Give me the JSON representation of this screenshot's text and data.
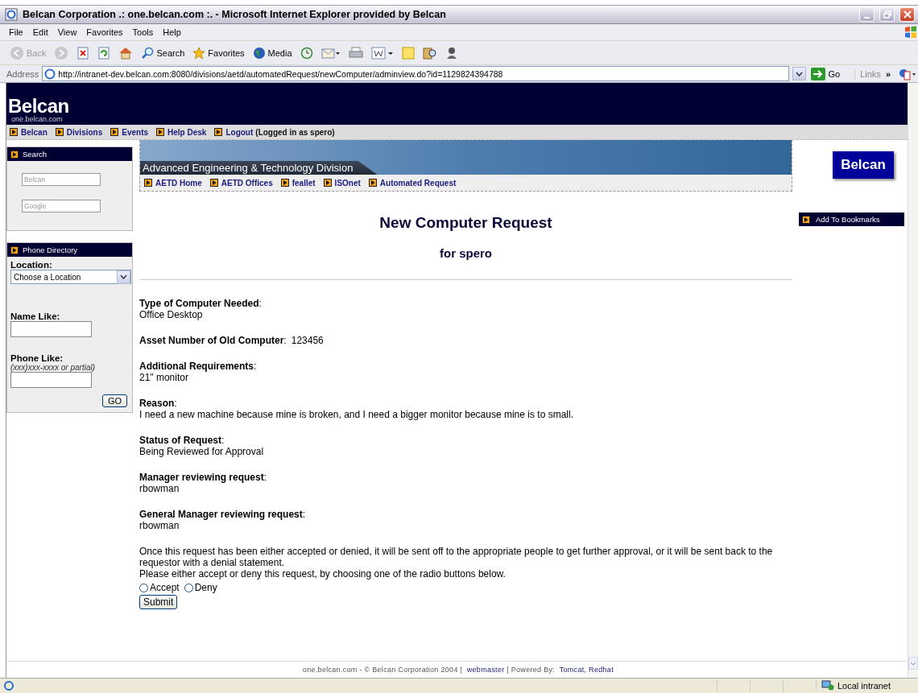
{
  "window": {
    "title": "Belcan Corporation .: one.belcan.com :. - Microsoft Internet Explorer provided by Belcan"
  },
  "menu": [
    "File",
    "Edit",
    "View",
    "Favorites",
    "Tools",
    "Help"
  ],
  "toolbar": [
    {
      "kind": "back",
      "label": "Back",
      "disabled": true
    },
    {
      "kind": "forward",
      "disabled": true
    },
    {
      "kind": "stop",
      "disabled": false
    },
    {
      "kind": "refresh",
      "disabled": false
    },
    {
      "kind": "home",
      "disabled": false
    },
    {
      "kind": "search",
      "label": "Search",
      "disabled": false
    },
    {
      "kind": "favorites",
      "label": "Favorites",
      "disabled": false
    },
    {
      "kind": "media",
      "label": "Media",
      "disabled": false
    },
    {
      "kind": "history",
      "disabled": false
    },
    {
      "kind": "mail",
      "disabled": false
    },
    {
      "kind": "print",
      "disabled": false
    },
    {
      "kind": "edit",
      "disabled": false
    },
    {
      "kind": "notes",
      "disabled": false
    },
    {
      "kind": "research",
      "disabled": false
    },
    {
      "kind": "messenger",
      "disabled": false
    }
  ],
  "address": {
    "label": "Address",
    "url": "http://intranet-dev.belcan.com:8080/divisions/aetd/automatedRequest/newComputer/adminview.do?id=1129824394788",
    "go": "Go",
    "links": "Links",
    "more": "»"
  },
  "site": {
    "logo": "Belcan",
    "logo_sub": "one.belcan.com",
    "nav": [
      "Belcan",
      "Divisions",
      "Events",
      "Help Desk",
      "Logout"
    ],
    "login_note": "(Logged in as spero)"
  },
  "search_panel": {
    "title": "Search",
    "fields": [
      {
        "placeholder": "Belcan"
      },
      {
        "placeholder": "Google"
      }
    ]
  },
  "phone_directory": {
    "title": "Phone Directory",
    "location_label": "Location:",
    "location_value": "Choose a Location",
    "name_label": "Name Like:",
    "phone_label": "Phone Like:",
    "phone_hint": "(xxx)xxx-xxxx or partial)",
    "go": "GO"
  },
  "division": {
    "title": "Advanced Engineering & Technology Division",
    "links": [
      "AETD Home",
      "AETD Offices",
      "feallet",
      "ISOnet",
      "Automated Request"
    ]
  },
  "right_panel": {
    "logo": "Belcan",
    "bookmark": "Add To Bookmarks"
  },
  "request": {
    "title": "New Computer Request",
    "subtitle": "for spero",
    "fields": [
      {
        "kind": "block",
        "label": "**Type of Computer Needed**:",
        "value": "Office Desktop"
      },
      {
        "kind": "inline",
        "label": "**Asset Number of Old Computer**:",
        "value": "123456"
      },
      {
        "kind": "block",
        "label": "**Additional Requirements**:",
        "value": "21\" monitor"
      },
      {
        "kind": "block",
        "label": "**Reason**:",
        "value": "I need a new machine because mine is broken, and I need a bigger monitor because mine is to small."
      },
      {
        "kind": "block",
        "label": "**Status of Request**:",
        "value": "Being Reviewed for Approval"
      },
      {
        "kind": "block",
        "label": "**Manager reviewing request**:",
        "value": "rbowman"
      },
      {
        "kind": "block",
        "label": "**General Manager reviewing request**:",
        "value": "rbowman"
      }
    ],
    "note": "Once this request has been either accepted or denied, it will be sent off to the appropriate people to get further approval, or it will be sent back to the requestor with a denial statement.",
    "instruction": "Please either accept or deny this request, by choosing one of the radio buttons below.",
    "choices": [
      {
        "label": "Accept",
        "selected": false
      },
      {
        "label": "Deny",
        "selected": false
      }
    ],
    "submit": "Submit"
  },
  "footer": [
    {
      "kind": "text",
      "text": "one.belcan.com - © Belcan Corporation 2004 |"
    },
    {
      "kind": "link",
      "text": "webmaster"
    },
    {
      "kind": "text",
      "text": "| Powered By:"
    },
    {
      "kind": "link",
      "text": "Tomcat,"
    },
    {
      "kind": "link",
      "text": "Redhat"
    }
  ],
  "status": {
    "zone": "Local intranet"
  }
}
